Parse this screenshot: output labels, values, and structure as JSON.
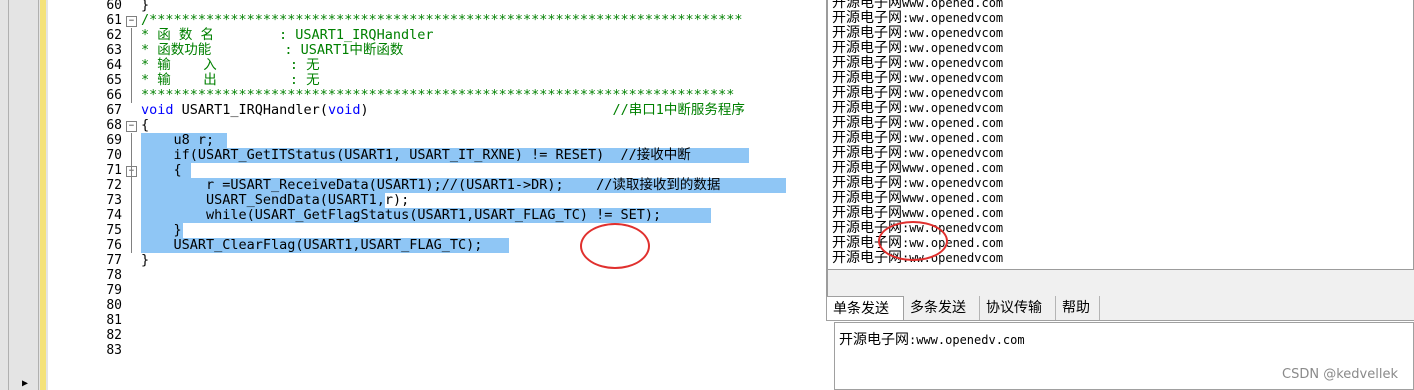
{
  "editor": {
    "line_numbers": [
      "60",
      "61",
      "62",
      "63",
      "64",
      "65",
      "66",
      "67",
      "68",
      "69",
      "70",
      "71",
      "72",
      "73",
      "74",
      "75",
      "76",
      "77",
      "78",
      "79",
      "80",
      "81",
      "82",
      "83"
    ],
    "lines": [
      {
        "text": "}",
        "kind": "plain"
      },
      {
        "text": "/*************************************************************************",
        "kind": "comment"
      },
      {
        "text": "* 函 数 名        : USART1_IRQHandler",
        "kind": "comment"
      },
      {
        "text": "* 函数功能         : USART1中断函数",
        "kind": "comment"
      },
      {
        "text": "* 输    入         : 无",
        "kind": "comment"
      },
      {
        "text": "* 输    出         : 无",
        "kind": "comment"
      },
      {
        "text": "*************************************************************************",
        "kind": "comment"
      },
      {
        "text": "void USART1_IRQHandler(void)",
        "kind": "signature",
        "comment": "//串口1中断服务程序"
      },
      {
        "text": "{",
        "kind": "plain"
      },
      {
        "text": "    u8 r;",
        "kind": "selected"
      },
      {
        "text": "    if(USART_GetITStatus(USART1, USART_IT_RXNE) != RESET)  //接收中断",
        "kind": "selected"
      },
      {
        "text": "    {",
        "kind": "selected"
      },
      {
        "text": "        r =USART_ReceiveData(USART1);//(USART1->DR);    //读取接收到的数据",
        "kind": "selected"
      },
      {
        "text": "        USART_SendData(USART1,r);",
        "kind": "selected"
      },
      {
        "text": "        while(USART_GetFlagStatus(USART1,USART_FLAG_TC) != SET);",
        "kind": "selected"
      },
      {
        "text": "    }",
        "kind": "selected"
      },
      {
        "text": "    USART_ClearFlag(USART1,USART_FLAG_TC);",
        "kind": "selected"
      },
      {
        "text": "}",
        "kind": "plain"
      },
      {
        "text": "",
        "kind": "plain"
      },
      {
        "text": "",
        "kind": "plain"
      },
      {
        "text": "",
        "kind": "plain"
      },
      {
        "text": "",
        "kind": "plain"
      },
      {
        "text": "",
        "kind": "plain"
      },
      {
        "text": "",
        "kind": "plain"
      }
    ]
  },
  "terminal": {
    "lines": [
      {
        "prefix": "开源电子网",
        "rest": "www.opened.com"
      },
      {
        "prefix": "开源电子网",
        "rest": ":ww.openedvcom"
      },
      {
        "prefix": "开源电子网",
        "rest": ":ww.openedvcom"
      },
      {
        "prefix": "开源电子网",
        "rest": ":ww.openedvcom"
      },
      {
        "prefix": "开源电子网",
        "rest": ":ww.openedvcom"
      },
      {
        "prefix": "开源电子网",
        "rest": ":ww.openedvcom"
      },
      {
        "prefix": "开源电子网",
        "rest": ":ww.openedvcom"
      },
      {
        "prefix": "开源电子网",
        "rest": ":ww.openedvcom"
      },
      {
        "prefix": "开源电子网",
        "rest": ":ww.opened.com"
      },
      {
        "prefix": "开源电子网",
        "rest": ":ww.opened.com"
      },
      {
        "prefix": "开源电子网",
        "rest": ":ww.openedvcom"
      },
      {
        "prefix": "开源电子网",
        "rest": "www.opened.com"
      },
      {
        "prefix": "开源电子网",
        "rest": ":ww.openedvcom"
      },
      {
        "prefix": "开源电子网",
        "rest": "www.opened.com"
      },
      {
        "prefix": "开源电子网",
        "rest": "www.opened.com"
      },
      {
        "prefix": "开源电子网",
        "rest": ":ww.openedvcom"
      },
      {
        "prefix": "开源电子网",
        "rest": ":ww.opened.com"
      },
      {
        "prefix": "开源电子网",
        "rest": ":ww.openedvcom"
      }
    ]
  },
  "tabs": [
    "单条发送",
    "多条发送",
    "协议传输",
    "帮助"
  ],
  "send_box": {
    "prefix": "开源电子网",
    "rest": ":www.openedv.com"
  },
  "watermark": "CSDN @kedvellek"
}
